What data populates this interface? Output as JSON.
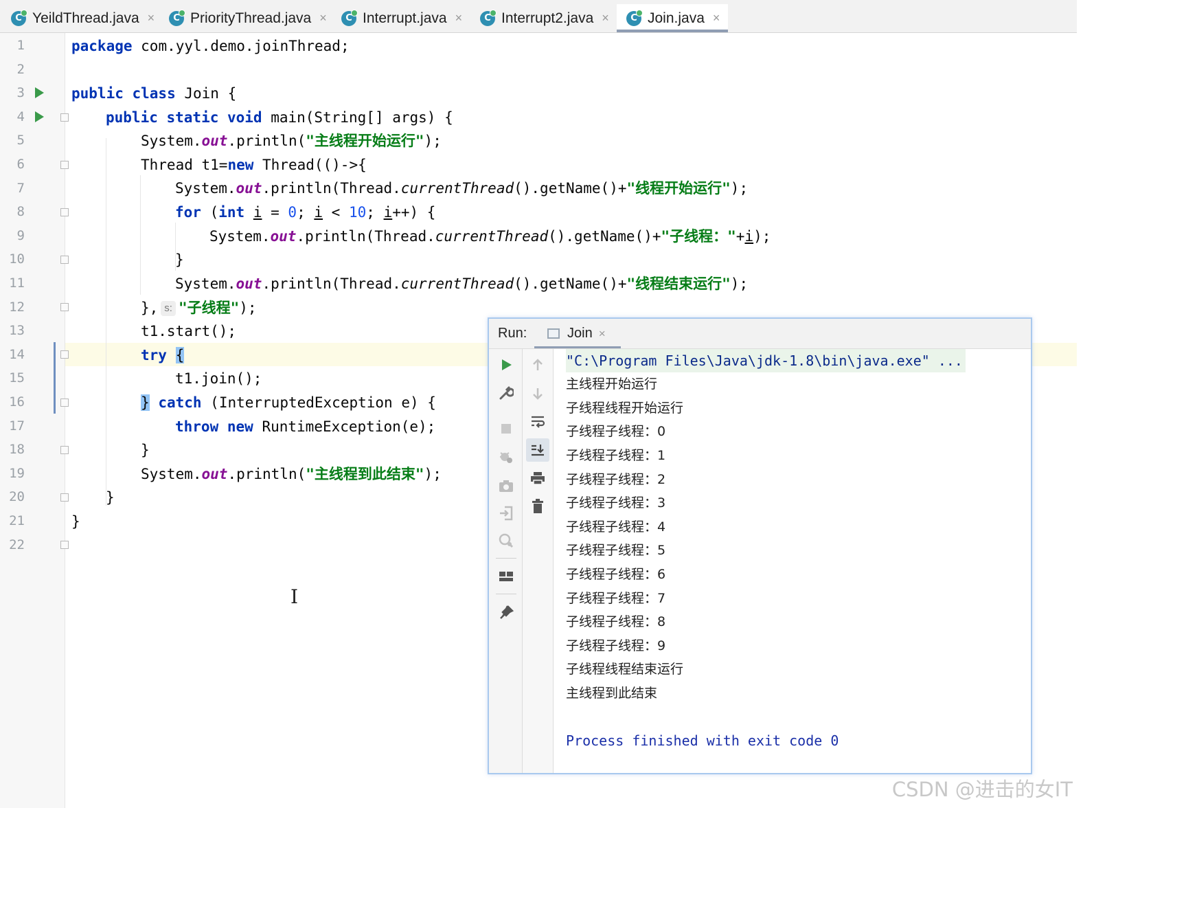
{
  "editor_tabs": [
    {
      "label": "YeildThread.java",
      "active": false
    },
    {
      "label": "PriorityThread.java",
      "active": false
    },
    {
      "label": "Interrupt.java",
      "active": false
    },
    {
      "label": "Interrupt2.java",
      "active": false
    },
    {
      "label": "Join.java",
      "active": true
    }
  ],
  "tab_icon_letter": "C",
  "close_glyph": "×",
  "line_numbers": [
    "1",
    "2",
    "3",
    "4",
    "5",
    "6",
    "7",
    "8",
    "9",
    "10",
    "11",
    "12",
    "13",
    "14",
    "15",
    "16",
    "17",
    "18",
    "19",
    "20",
    "21",
    "22"
  ],
  "current_line": 14,
  "code": {
    "l1_kw": "package",
    "l1_rest": " com.yyl.demo.joinThread;",
    "l3_kw": "public class",
    "l3_rest": " Join {",
    "l4_kw": "public static void",
    "l4_rest": " main(String[] args) {",
    "l5_a": "System.",
    "l5_field": "out",
    "l5_b": ".println(",
    "l5_str": "\"主线程开始运行\"",
    "l5_c": ");",
    "l6_a": "Thread t1=",
    "l6_kw": "new",
    "l6_b": " Thread(()->{",
    "l7_a": "System.",
    "l7_field": "out",
    "l7_b": ".println(Thread.",
    "l7_italic": "currentThread",
    "l7_c": "().getName()+",
    "l7_str": "\"线程开始运行\"",
    "l7_d": ");",
    "l8_kw1": "for",
    "l8_a": " (",
    "l8_kw2": "int",
    "l8_sp": " ",
    "l8_var": "i",
    "l8_b": " = ",
    "l8_n1": "0",
    "l8_c": "; ",
    "l8_var2": "i",
    "l8_d": " < ",
    "l8_n2": "10",
    "l8_e": "; ",
    "l8_var3": "i",
    "l8_f": "++) {",
    "l9_a": "System.",
    "l9_field": "out",
    "l9_b": ".println(Thread.",
    "l9_italic": "currentThread",
    "l9_c": "().getName()+",
    "l9_str": "\"子线程：\"",
    "l9_d": "+",
    "l9_var": "i",
    "l9_e": ");",
    "l10": "}",
    "l11_a": "System.",
    "l11_field": "out",
    "l11_b": ".println(Thread.",
    "l11_italic": "currentThread",
    "l11_c": "().getName()+",
    "l11_str": "\"线程结束运行\"",
    "l11_d": ");",
    "l12_a": "},",
    "l12_hint": "s:",
    "l12_str": "\"子线程\"",
    "l12_b": ");",
    "l13": "t1.start();",
    "l14_kw": "try",
    "l14_sp": " ",
    "l14_brace": "{",
    "l15": "t1.join();",
    "l16_brace": "}",
    "l16_sp": " ",
    "l16_kw": "catch",
    "l16_rest": " (InterruptedException e) {",
    "l17_kw1": "throw",
    "l17_sp": " ",
    "l17_kw2": "new",
    "l17_rest": " RuntimeException(e);",
    "l18": "}",
    "l19_a": "System.",
    "l19_field": "out",
    "l19_b": ".println(",
    "l19_str": "\"主线程到此结束\"",
    "l19_c": ");",
    "l20": "}",
    "l21": "}"
  },
  "run_panel": {
    "label": "Run:",
    "tab_label": "Join",
    "command": "\"C:\\Program Files\\Java\\jdk-1.8\\bin\\java.exe\" ...",
    "output": [
      "主线程开始运行",
      "子线程线程开始运行",
      "子线程子线程：0",
      "子线程子线程：1",
      "子线程子线程：2",
      "子线程子线程：3",
      "子线程子线程：4",
      "子线程子线程：5",
      "子线程子线程：6",
      "子线程子线程：7",
      "子线程子线程：8",
      "子线程子线程：9",
      "子线程线程结束运行",
      "主线程到此结束"
    ],
    "exit_message": "Process finished with exit code 0",
    "left_toolbar_icons": [
      "rerun-icon",
      "wrench-icon",
      "stop-icon",
      "debug-settings-icon",
      "camera-icon",
      "login-icon",
      "search-settings-icon",
      "layout-icon",
      "pin-icon"
    ],
    "right_toolbar_icons": [
      "up-arrow-icon",
      "down-arrow-icon",
      "soft-wrap-icon",
      "scroll-to-end-icon",
      "print-icon",
      "trash-icon"
    ]
  },
  "watermark": "CSDN @进击的女IT",
  "colors": {
    "keyword": "#0033b3",
    "string": "#067d17",
    "number": "#1750eb",
    "field": "#871094",
    "console_exit": "#1a2fa8",
    "run_green": "#3a9a4a"
  }
}
